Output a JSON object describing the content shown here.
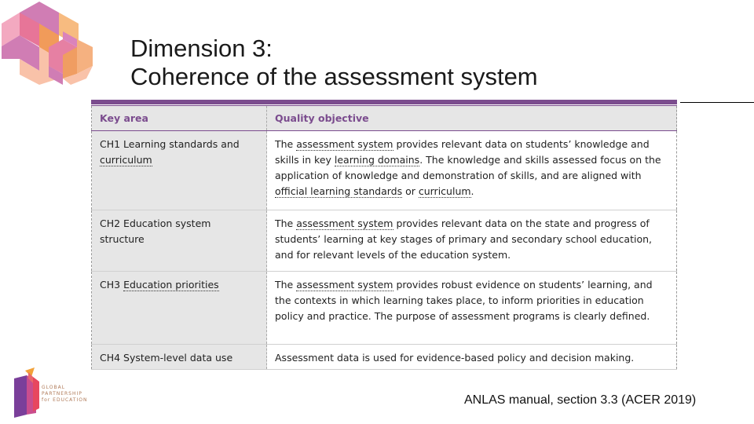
{
  "slide": {
    "title_line1": "Dimension 3:",
    "title_line2": "Coherence of the assessment system",
    "source": "ANLAS manual, section 3.3 (ACER 2019)",
    "logo_text": [
      "GLOBAL",
      "PARTNERSHIP",
      "for EDUCATION"
    ]
  },
  "table": {
    "headers": [
      "Key area",
      "Quality objective"
    ],
    "rows": [
      {
        "key": [
          "CH1 Learning standards and ",
          "curriculum",
          ""
        ],
        "objective": [
          "The ",
          "assessment system",
          " provides relevant data on students’ knowledge and skills in key ",
          "learning domains",
          ". The knowledge and skills assessed focus on the application of knowledge and demonstration of skills, and are aligned with ",
          "official learning standards",
          " or ",
          "curriculum",
          "."
        ]
      },
      {
        "key": [
          "CH2 Education system structure",
          "",
          ""
        ],
        "objective": [
          "The ",
          "assessment system",
          " provides relevant data on the state and progress of students’ learning at key stages of primary and secondary school education, and for relevant levels of the education system.",
          "",
          "",
          "",
          "",
          "",
          ""
        ]
      },
      {
        "key": [
          "CH3 ",
          "Education priorities",
          ""
        ],
        "objective": [
          "The ",
          "assessment system",
          " provides robust evidence on students’ learning, and the contexts in which learning takes place, to inform priorities in education policy and practice. The purpose of assessment programs is clearly defined.",
          "",
          "",
          "",
          "",
          "",
          ""
        ]
      },
      {
        "key": [
          "CH4 System-level data use",
          "",
          ""
        ],
        "objective": [
          "Assessment data is used for evidence-based policy and decision making.",
          "",
          "",
          "",
          "",
          "",
          "",
          "",
          ""
        ]
      }
    ]
  },
  "colors": {
    "accent": "#7b4c8e",
    "key_column_bg": "#e6e6e6"
  }
}
